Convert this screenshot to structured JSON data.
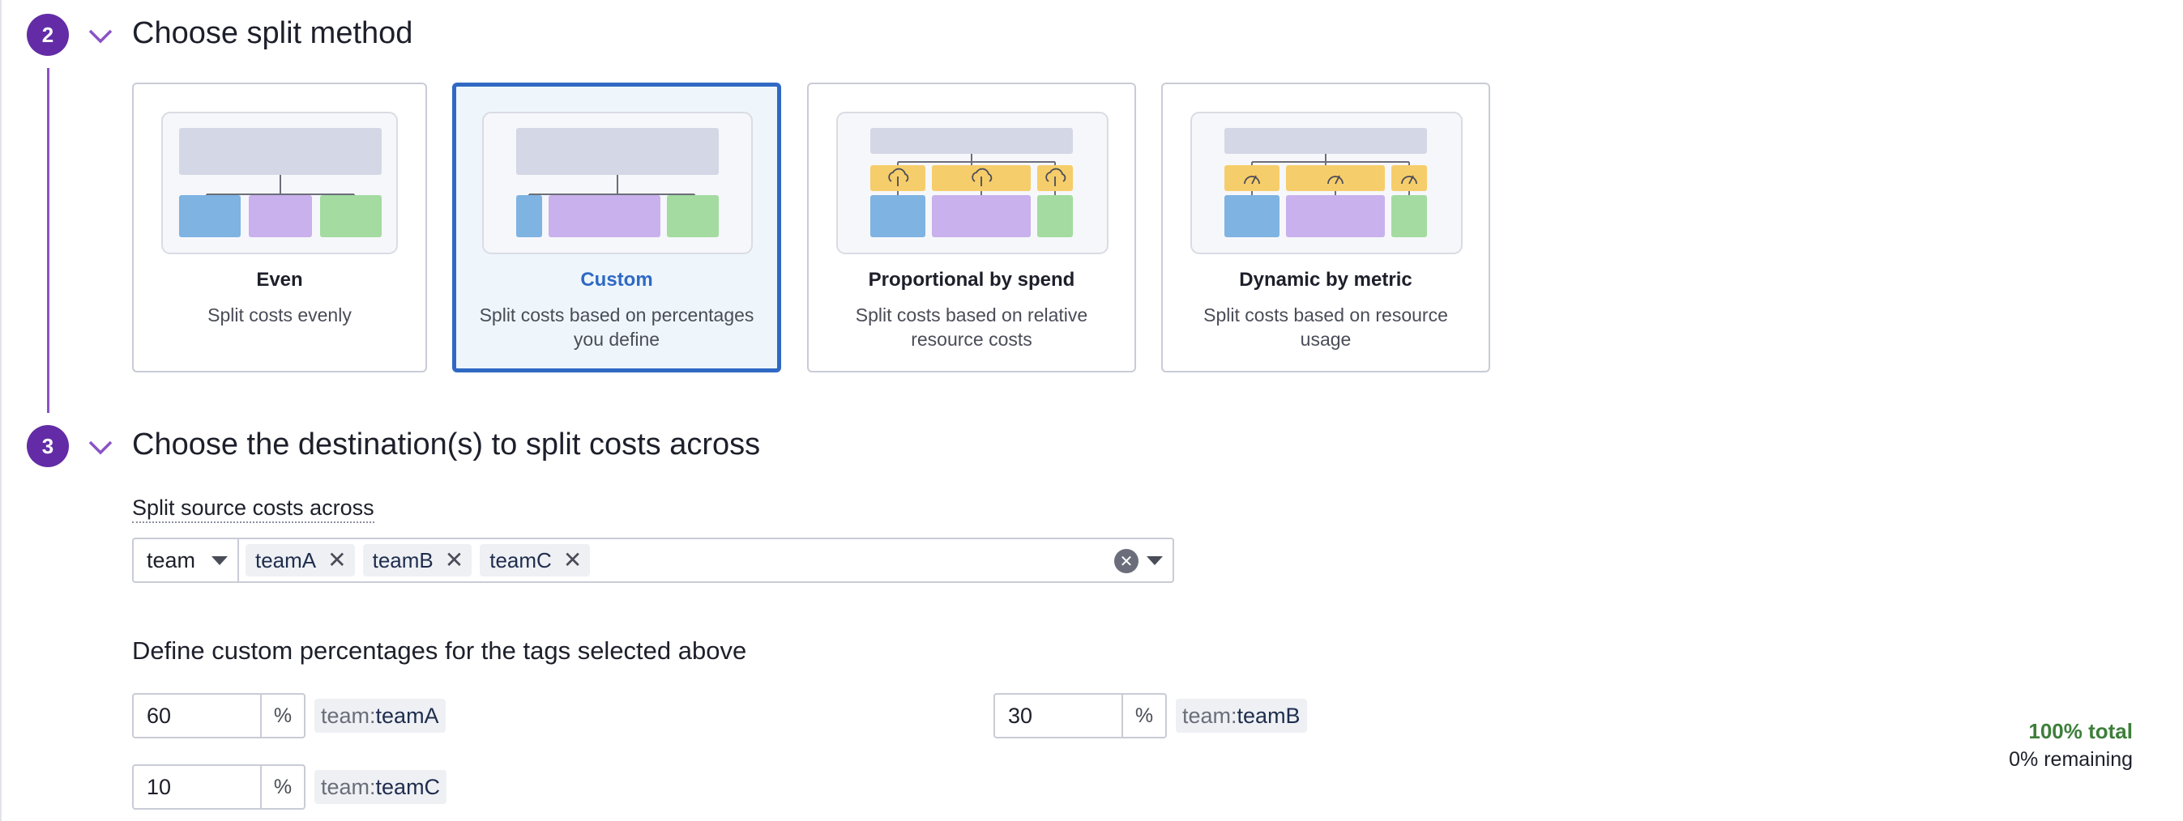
{
  "step2": {
    "number": "2",
    "title": "Choose split method",
    "cards": [
      {
        "title": "Even",
        "desc": "Split costs evenly",
        "selected": false
      },
      {
        "title": "Custom",
        "desc": "Split costs based on percentages you define",
        "selected": true
      },
      {
        "title": "Proportional by spend",
        "desc": "Split costs based on relative resource costs",
        "selected": false
      },
      {
        "title": "Dynamic by metric",
        "desc": "Split costs based on resource usage",
        "selected": false
      }
    ]
  },
  "step3": {
    "number": "3",
    "title": "Choose the destination(s) to split costs across",
    "field_label": "Split source costs across",
    "tag_key": "team",
    "tag_values": [
      "teamA",
      "teamB",
      "teamC"
    ],
    "custom_label": "Define custom percentages for the tags selected above",
    "percent_sign": "%",
    "allocations": [
      {
        "value": "60",
        "key": "team:",
        "tag": "teamA"
      },
      {
        "value": "30",
        "key": "team:",
        "tag": "teamB"
      },
      {
        "value": "10",
        "key": "team:",
        "tag": "teamC"
      }
    ],
    "total": "100% total",
    "remaining": "0% remaining"
  },
  "colors": {
    "accent_purple": "#632ca6",
    "selected_blue": "#2f69c3",
    "total_green": "#3d7f3a",
    "diagram_blue": "#7eb3e2",
    "diagram_purple": "#c8b1ec",
    "diagram_green": "#a3dba0",
    "diagram_yellow": "#f6cd6b"
  },
  "icons": {
    "chevron": "chevron-down-icon",
    "remove": "close-icon",
    "clear": "clear-circle-icon",
    "cost": "cloud-dollar-icon",
    "metric": "gauge-icon"
  }
}
